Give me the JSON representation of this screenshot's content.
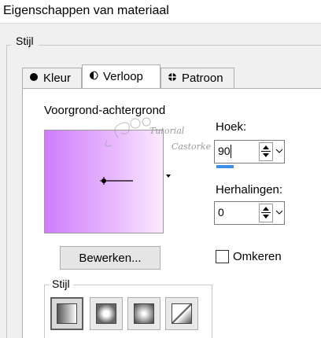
{
  "window": {
    "title": "Eigenschappen van materiaal"
  },
  "style_group": {
    "label": "Stijl"
  },
  "tabs": [
    {
      "label": "Kleur",
      "icon": "filled-circle-icon",
      "active": false
    },
    {
      "label": "Verloop",
      "icon": "half-circle-icon",
      "active": true
    },
    {
      "label": "Patroon",
      "icon": "pattern-icon",
      "active": false
    }
  ],
  "gradient": {
    "label": "Voorgrond-achtergrond",
    "colors": [
      "#cf7dfb",
      "#e6b5fd",
      "#fbe9ff"
    ]
  },
  "angle": {
    "label": "Hoek:",
    "value": "90"
  },
  "repeats": {
    "label": "Herhalingen:",
    "value": "0"
  },
  "edit_button": {
    "label": "Bewerken..."
  },
  "invert": {
    "label": "Omkeren",
    "checked": false
  },
  "style_subgroup": {
    "label": "Stijl",
    "options": [
      {
        "name": "linear",
        "selected": true
      },
      {
        "name": "rectangular",
        "selected": false
      },
      {
        "name": "sunburst",
        "selected": false
      },
      {
        "name": "radial",
        "selected": false
      }
    ]
  },
  "watermark": {
    "line1": "Tutorial",
    "line2": "Castorke"
  }
}
